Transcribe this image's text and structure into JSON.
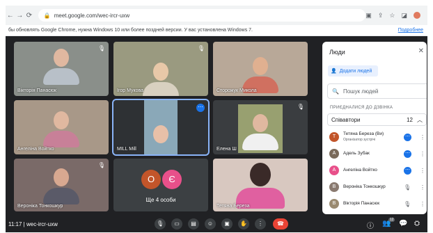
{
  "browser": {
    "url": "meet.google.com/wec-ircr-uxw",
    "nav": [
      "←",
      "→",
      "⟳"
    ]
  },
  "infobar": {
    "message": "бы обновлять Google Chrome, нужна Windows 10 или более поздней версии. У вас установлена Windows 7.",
    "more": "Подробнее"
  },
  "tiles": [
    {
      "name": "Вікторія Панасюк"
    },
    {
      "name": "Ігор Мукова"
    },
    {
      "name": "Сторожук Микола"
    },
    {
      "name": "Ангеліна Войтко"
    },
    {
      "name": "MILL Mill"
    },
    {
      "name": "Елена Ш"
    },
    {
      "name": "Вероніка Тонкошкур"
    },
    {
      "name": "Ще 4 особи",
      "avatars": [
        "О",
        "Є"
      ]
    },
    {
      "name": "Тетяна Береза"
    }
  ],
  "panel": {
    "title": "Люди",
    "add_label": "Додати людей",
    "search_placeholder": "Пошук людей",
    "section": "ПРИЄДНАЛИСЯ ДО ДЗВІНКА",
    "group_label": "Співавтори",
    "group_count": "12",
    "people": [
      {
        "initial": "Т",
        "name": "Тетяна Береза (Ви)",
        "sub": "Організатор зустрічі",
        "color": "#c2552a",
        "status": "speaking"
      },
      {
        "initial": "А",
        "name": "Адель Зубак",
        "sub": "",
        "color": "#7a6a5a",
        "status": "speaking"
      },
      {
        "initial": "А",
        "name": "Ангеліна Войтко",
        "sub": "",
        "color": "#e8508a",
        "status": "speaking"
      },
      {
        "initial": "В",
        "name": "Вероніка Тонкошкур",
        "sub": "",
        "color": "#8a7a70",
        "status": "muted"
      },
      {
        "initial": "В",
        "name": "Вікторія Панасюк",
        "sub": "",
        "color": "#9a8a70",
        "status": "muted"
      }
    ]
  },
  "bottombar": {
    "time": "11:17",
    "code": "wec-ircr-uxw",
    "participant_badge": "12"
  },
  "colors": {
    "meet_bg": "#202124",
    "tile_bg": "#3c4043",
    "accent": "#1a73e8",
    "end_call": "#ea4335"
  }
}
